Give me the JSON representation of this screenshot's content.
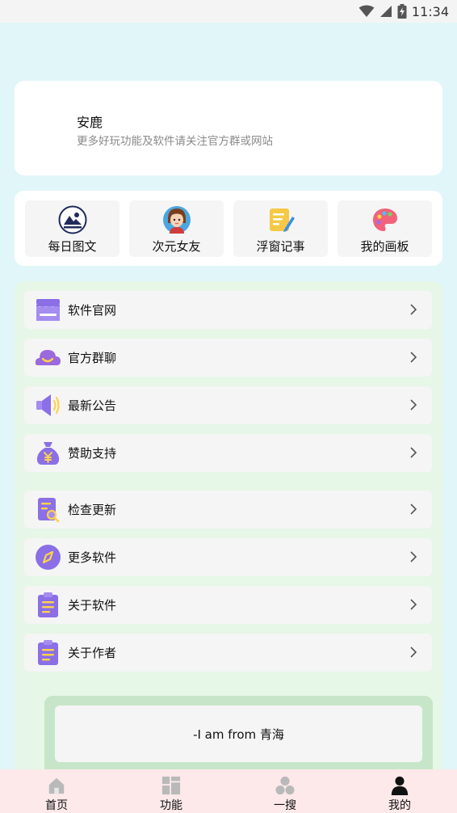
{
  "status_bar": {
    "time": "11:34"
  },
  "profile": {
    "name": "安鹿",
    "subtitle": "更多好玩功能及软件请关注官方群或网站"
  },
  "quick_actions": [
    {
      "label": "每日图文",
      "icon": "daily-picture-icon"
    },
    {
      "label": "次元女友",
      "icon": "anime-girl-icon"
    },
    {
      "label": "浮窗记事",
      "icon": "notepad-pencil-icon"
    },
    {
      "label": "我的画板",
      "icon": "palette-icon"
    }
  ],
  "menu": {
    "items": [
      {
        "label": "软件官网",
        "icon": "storefront-icon"
      },
      {
        "label": "官方群聊",
        "icon": "chat-cloud-icon"
      },
      {
        "label": "最新公告",
        "icon": "speaker-icon"
      },
      {
        "label": "赞助支持",
        "icon": "money-bag-icon"
      },
      {
        "label": "检查更新",
        "icon": "document-search-icon"
      },
      {
        "label": "更多软件",
        "icon": "compass-icon"
      },
      {
        "label": "关于软件",
        "icon": "clipboard-icon"
      },
      {
        "label": "关于作者",
        "icon": "clipboard-icon"
      }
    ]
  },
  "footer": {
    "text": "-I am from 青海"
  },
  "bottom_nav": {
    "items": [
      {
        "label": "首页",
        "icon": "home-icon",
        "active": false
      },
      {
        "label": "功能",
        "icon": "grid-icon",
        "active": false
      },
      {
        "label": "一搜",
        "icon": "circles-icon",
        "active": false
      },
      {
        "label": "我的",
        "icon": "person-icon",
        "active": true
      }
    ]
  },
  "colors": {
    "background": "#e1f6f8",
    "menu_panel": "#e6f6e7",
    "accent_purple": "#8b6fe6",
    "bottom_nav_bg": "#fde9ea",
    "footer_box": "#c7e6c9"
  }
}
